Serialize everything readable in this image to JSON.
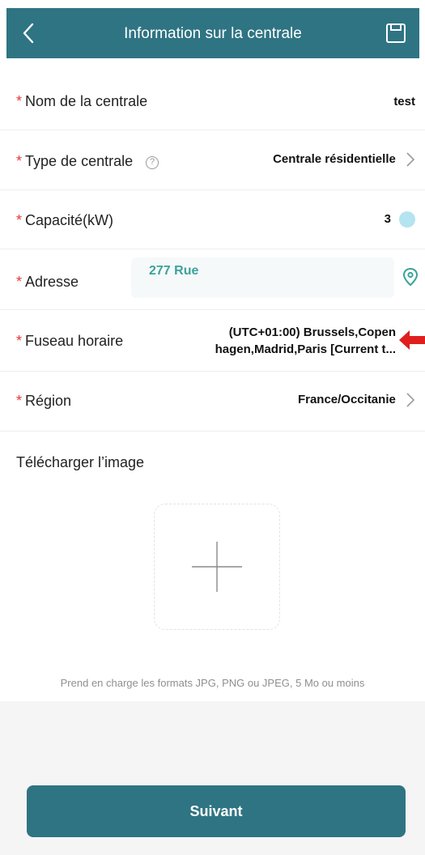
{
  "header": {
    "title": "Information sur la centrale",
    "back_icon": "chevron-left-icon",
    "save_icon": "save-icon"
  },
  "form": {
    "name": {
      "required_mark": "*",
      "label": "Nom de la centrale",
      "value": "test"
    },
    "type": {
      "required_mark": "*",
      "label": "Type de centrale",
      "help_glyph": "?",
      "value": "Centrale résidentielle"
    },
    "capacity": {
      "required_mark": "*",
      "label": "Capacité(kW)",
      "value": "3"
    },
    "address": {
      "required_mark": "*",
      "label": "Adresse",
      "value": "277 Rue"
    },
    "timezone": {
      "required_mark": "*",
      "label": "Fuseau horaire",
      "value_line1": "(UTC+01:00) Brussels,Copen",
      "value_line2": "hagen,Madrid,Paris [Current t..."
    },
    "region": {
      "required_mark": "*",
      "label": "Région",
      "value": "France/Occitanie"
    }
  },
  "upload": {
    "title": "Télécharger l’image",
    "formats_hint": "Prend en charge les formats JPG, PNG ou JPEG, 5 Mo ou moins"
  },
  "footer": {
    "next_label": "Suivant"
  },
  "colors": {
    "header_bg": "#2f7483",
    "required": "#e53935",
    "address_text": "#3ba39a",
    "pointer_arrow": "#e01e1e"
  }
}
